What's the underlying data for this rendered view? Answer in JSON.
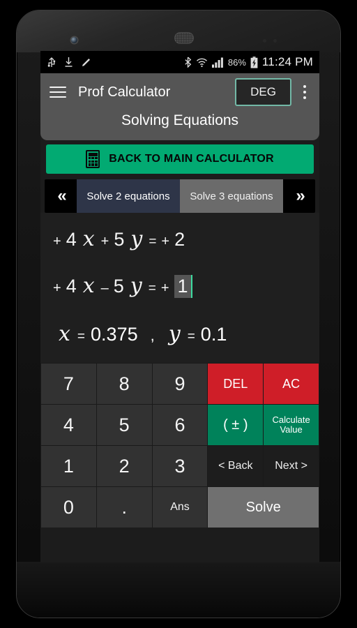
{
  "statusbar": {
    "icons_left": [
      "usb-icon",
      "download-icon",
      "pencil-icon"
    ],
    "icons_right": [
      "bluetooth-icon",
      "wifi-icon",
      "signal-icon"
    ],
    "battery_pct": "86%",
    "battery_icon": "battery-charging-icon",
    "clock": "11:24 PM"
  },
  "appbar": {
    "menu_icon": "hamburger-menu-icon",
    "title": "Prof Calculator",
    "angle_mode": "DEG",
    "overflow_icon": "overflow-menu-icon",
    "subtitle": "Solving Equations"
  },
  "main_button": {
    "icon": "calculator-icon",
    "label": "BACK TO MAIN CALCULATOR",
    "color": "#02aa72"
  },
  "tabs": {
    "prev_arrow": "«",
    "next_arrow": "»",
    "items": [
      {
        "label": "Solve 2 equations",
        "selected": true
      },
      {
        "label": "Solve 3 equations",
        "selected": false
      }
    ],
    "selected_color": "#2e3548",
    "unselected_color": "#6b6b6b"
  },
  "display": {
    "equation1": {
      "sign_a": "+",
      "coeff_a": "4",
      "var_a": "x",
      "sign_b": "+",
      "coeff_b": "5",
      "var_b": "y",
      "equals": "=",
      "sign_c": "+",
      "constant": "2"
    },
    "equation2": {
      "sign_a": "+",
      "coeff_a": "4",
      "var_a": "x",
      "sign_b": "–",
      "coeff_b": "5",
      "var_b": "y",
      "equals": "=",
      "sign_c": "+",
      "constant": "1"
    },
    "result": {
      "var_x": "x",
      "eq1": "=",
      "value_x": "0.375",
      "separator": ",",
      "var_y": "y",
      "eq2": "=",
      "value_y": "0.1"
    },
    "cursor_color": "#3ddba0"
  },
  "keypad": {
    "rows": [
      [
        {
          "label": "7",
          "style": "num"
        },
        {
          "label": "8",
          "style": "num"
        },
        {
          "label": "9",
          "style": "num"
        },
        {
          "label": "DEL",
          "style": "red"
        },
        {
          "label": "AC",
          "style": "red"
        }
      ],
      [
        {
          "label": "4",
          "style": "num"
        },
        {
          "label": "5",
          "style": "num"
        },
        {
          "label": "6",
          "style": "num"
        },
        {
          "label": "( ± )",
          "style": "green"
        },
        {
          "label": "Calculate Value",
          "style": "green-small"
        }
      ],
      [
        {
          "label": "1",
          "style": "num"
        },
        {
          "label": "2",
          "style": "num"
        },
        {
          "label": "3",
          "style": "num"
        },
        {
          "label": "< Back",
          "style": "dark"
        },
        {
          "label": "Next >",
          "style": "dark"
        }
      ],
      [
        {
          "label": "0",
          "style": "num"
        },
        {
          "label": ".",
          "style": "num"
        },
        {
          "label": "Ans",
          "style": "small"
        },
        {
          "label": "Solve",
          "style": "gray-wide"
        }
      ]
    ],
    "colors": {
      "delete": "#cf1e28",
      "action": "#00825a",
      "solve": "#707070"
    }
  }
}
